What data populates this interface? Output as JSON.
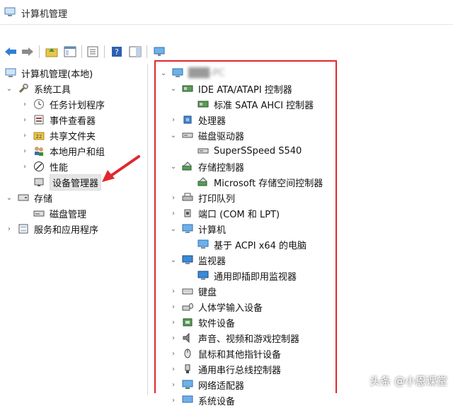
{
  "window": {
    "title": "计算机管理"
  },
  "left_tree": {
    "root": "计算机管理(本地)",
    "system_tools": "系统工具",
    "items": [
      "任务计划程序",
      "事件查看器",
      "共享文件夹",
      "本地用户和组",
      "性能",
      "设备管理器"
    ],
    "storage": "存储",
    "disk_management": "磁盘管理",
    "services": "服务和应用程序"
  },
  "device_tree": {
    "computer_name": "███-PC",
    "ide": {
      "label": "IDE ATA/ATAPI 控制器",
      "child": "标准 SATA AHCI 控制器"
    },
    "processor": "处理器",
    "disk": {
      "label": "磁盘驱动器",
      "child": "SuperSSpeed S540"
    },
    "storage_ctrl": {
      "label": "存储控制器",
      "child": "Microsoft 存储空间控制器"
    },
    "print_queue": "打印队列",
    "ports": "端口 (COM 和 LPT)",
    "computer": {
      "label": "计算机",
      "child": "基于 ACPI x64 的电脑"
    },
    "monitor": {
      "label": "监视器",
      "child": "通用即插即用监视器"
    },
    "keyboard": "键盘",
    "hid": "人体学输入设备",
    "software": "软件设备",
    "audio": "声音、视频和游戏控制器",
    "mouse": "鼠标和其他指针设备",
    "usb": "通用串行总线控制器",
    "network": "网络适配器",
    "system": "系统设备"
  },
  "watermark": "头条 @小恩课堂",
  "colors": {
    "highlight": "#e0282e",
    "icon_blue": "#2f6fd0",
    "icon_green": "#3a8a3a"
  }
}
